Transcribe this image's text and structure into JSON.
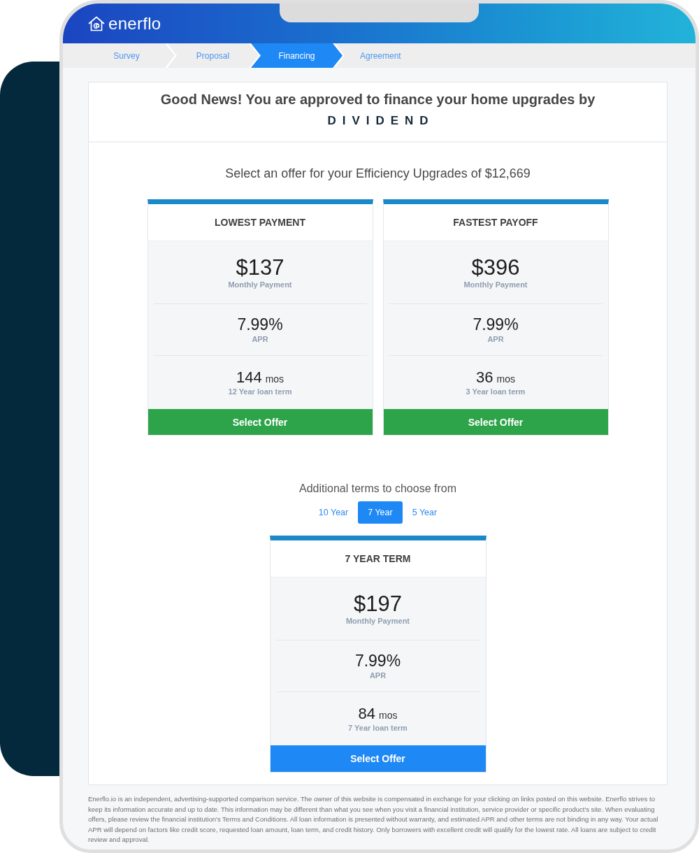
{
  "app": {
    "logo": "enerflo"
  },
  "steps": [
    {
      "label": "Survey",
      "selected": false
    },
    {
      "label": "Proposal",
      "selected": false
    },
    {
      "label": "Financing",
      "selected": true
    },
    {
      "label": "Agreement",
      "selected": false
    }
  ],
  "approval": {
    "title": "Good News! You are approved to finance your home upgrades by",
    "lender_logo": "DIVIDEND"
  },
  "offer_prompt": "Select an offer for your Efficiency Upgrades of $12,669",
  "offers": [
    {
      "heading": "LOWEST PAYMENT",
      "payment": "$137",
      "payment_label": "Monthly Payment",
      "apr": "7.99%",
      "apr_label": "APR",
      "term": "144",
      "term_unit": "mos",
      "term_label": "12 Year loan term",
      "button": "Select Offer"
    },
    {
      "heading": "FASTEST PAYOFF",
      "payment": "$396",
      "payment_label": "Monthly Payment",
      "apr": "7.99%",
      "apr_label": "APR",
      "term": "36",
      "term_unit": "mos",
      "term_label": "3 Year loan term",
      "button": "Select Offer"
    }
  ],
  "additional_terms": {
    "title": "Additional terms to choose from",
    "tabs": [
      {
        "label": "10 Year",
        "selected": false
      },
      {
        "label": "7 Year",
        "selected": true
      },
      {
        "label": "5 Year",
        "selected": false
      }
    ],
    "offer": {
      "heading": "7 YEAR TERM",
      "payment": "$197",
      "payment_label": "Monthly Payment",
      "apr": "7.99%",
      "apr_label": "APR",
      "term": "84",
      "term_unit": "mos",
      "term_label": "7 Year loan term",
      "button": "Select Offer"
    }
  },
  "disclaimer": "Enerflo.io is an independent, advertising-supported comparison service. The owner of this website is compensated in exchange for your clicking on links posted on this website. Enerflo strives to keep its information accurate and up to date. This information may be different than what you see when you visit a financial institution, service provider or specific product's site. When evaluating offers, please review the financial institution's Terms and Conditions. All loan information is presented without warranty, and estimated APR and other terms are not binding in any way. Your actual APR will depend on factors like credit score, requested loan amount, loan term, and credit history. Only borrowers with excellent credit will qualify for the lowest rate. All loans are subject to credit review and approval."
}
